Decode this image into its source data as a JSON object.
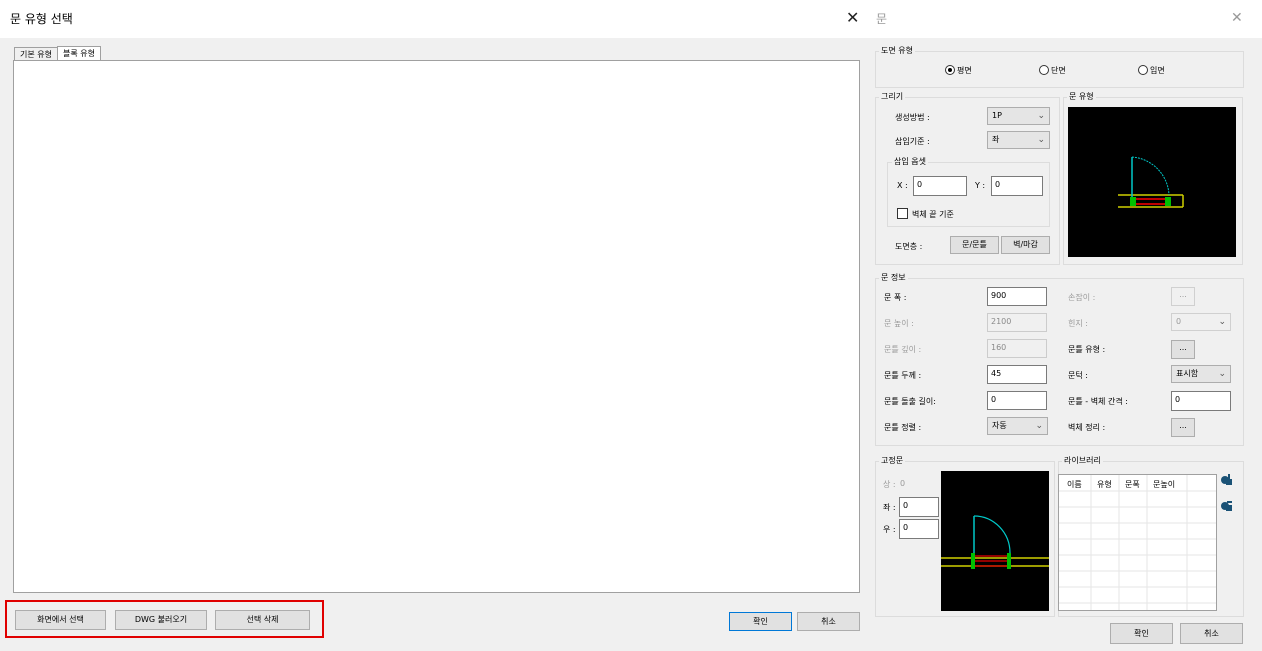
{
  "left_dialog": {
    "title": "문 유형 선택",
    "tabs": [
      "기본 유형",
      "블록 유형"
    ],
    "active_tab": 1,
    "buttons": {
      "select_on_screen": "화면에서 선택",
      "load_dwg": "DWG 불러오기",
      "delete_selection": "선택 삭제",
      "ok": "확인",
      "cancel": "취소"
    }
  },
  "right_dialog": {
    "title": "문",
    "drawing_type": {
      "label": "도면 유형",
      "options": [
        "평면",
        "단면",
        "입면"
      ],
      "selected": 0
    },
    "draw": {
      "label": "그리기",
      "method_label": "생성방법 :",
      "method_value": "1P",
      "insert_base_label": "삽입기준 :",
      "insert_base_value": "좌",
      "offset_label": "삽입 옵셋",
      "x_label": "X :",
      "x_value": "0",
      "y_label": "Y :",
      "y_value": "0",
      "wall_end_label": "벽체 끝 기준",
      "layer_label": "도면층 :",
      "door_frame_btn": "문/문틀",
      "wall_finish_btn": "벽/마감"
    },
    "door_type": {
      "label": "문 유형"
    },
    "door_info": {
      "label": "문 정보",
      "width_label": "문 폭 :",
      "width_value": "900",
      "height_label": "문 높이 :",
      "height_value": "2100",
      "frame_depth_label": "문틀 깊이 :",
      "frame_depth_value": "160",
      "frame_thickness_label": "문틀 두께 :",
      "frame_thickness_value": "45",
      "frame_protrusion_label": "문틀 돌출 길이:",
      "frame_protrusion_value": "0",
      "frame_align_label": "문틀 정렬 :",
      "frame_align_value": "자동",
      "handle_label": "손잡이 :",
      "handle_btn": "...",
      "hinge_label": "힌지 :",
      "hinge_value": "0",
      "frame_type_label": "문틀 유형 :",
      "frame_type_btn": "...",
      "threshold_label": "문턱 :",
      "threshold_value": "표시함",
      "frame_wall_gap_label": "문틀 - 벽체 간격 :",
      "frame_wall_gap_value": "0",
      "wall_cleanup_label": "벽체 정리 :",
      "wall_cleanup_btn": "..."
    },
    "fixed_door": {
      "label": "고정문",
      "top_label": "상 :",
      "top_value": "0",
      "left_label": "좌 :",
      "left_value": "0",
      "right_label": "우 :",
      "right_value": "0"
    },
    "library": {
      "label": "라이브러리",
      "columns": [
        "이름",
        "유형",
        "문폭",
        "문높이"
      ]
    },
    "buttons": {
      "ok": "확인",
      "cancel": "취소"
    }
  },
  "colors": {
    "highlight": "#e00000",
    "preview_bg": "#000000",
    "door_arc": "#00c8c8",
    "wall": "#d0d000",
    "frame": "#00c000",
    "threshold": "#c00000",
    "lib_icon": "#1a5276"
  }
}
